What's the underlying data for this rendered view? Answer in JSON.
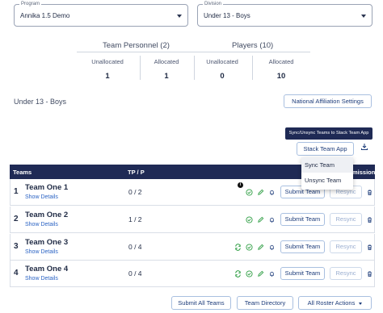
{
  "filters": {
    "program": {
      "label": "Program",
      "value": "Annika 1.5 Demo"
    },
    "division": {
      "label": "Division",
      "value": "Under 13 - Boys"
    }
  },
  "stats": {
    "team_personnel": {
      "title": "Team Personnel (2)",
      "unallocated_label": "Unallocated",
      "unallocated": "1",
      "allocated_label": "Allocated",
      "allocated": "1"
    },
    "players": {
      "title": "Players (10)",
      "unallocated_label": "Unallocated",
      "unallocated": "0",
      "allocated_label": "Allocated",
      "allocated": "10"
    }
  },
  "division_title": "Under 13 - Boys",
  "buttons": {
    "national_affiliation": "National Affiliation Settings",
    "stack_team_app": "Stack Team App",
    "submit_all": "Submit All Teams",
    "team_directory": "Team Directory",
    "all_roster_actions": "All Roster Actions"
  },
  "tooltip": "Sync/Unsync Teams to Stack Team App",
  "stack_menu": [
    "Sync Team",
    "Unsync Team"
  ],
  "table": {
    "headers": {
      "teams": "Teams",
      "tp": "TP / P",
      "mission": "mission"
    },
    "submit_label": "Submit Team",
    "resync_label": "Resync",
    "show_details": "Show Details",
    "rows": [
      {
        "num": "1",
        "name": "Team One 1",
        "tp": "0 / 2"
      },
      {
        "num": "2",
        "name": "Team One 2",
        "tp": "1 / 2"
      },
      {
        "num": "3",
        "name": "Team One 3",
        "tp": "0 / 4"
      },
      {
        "num": "4",
        "name": "Team One 4",
        "tp": "0 / 4"
      }
    ]
  },
  "colors": {
    "navy": "#1f2a55",
    "link": "#2b63c4",
    "green": "#2f9e44"
  }
}
